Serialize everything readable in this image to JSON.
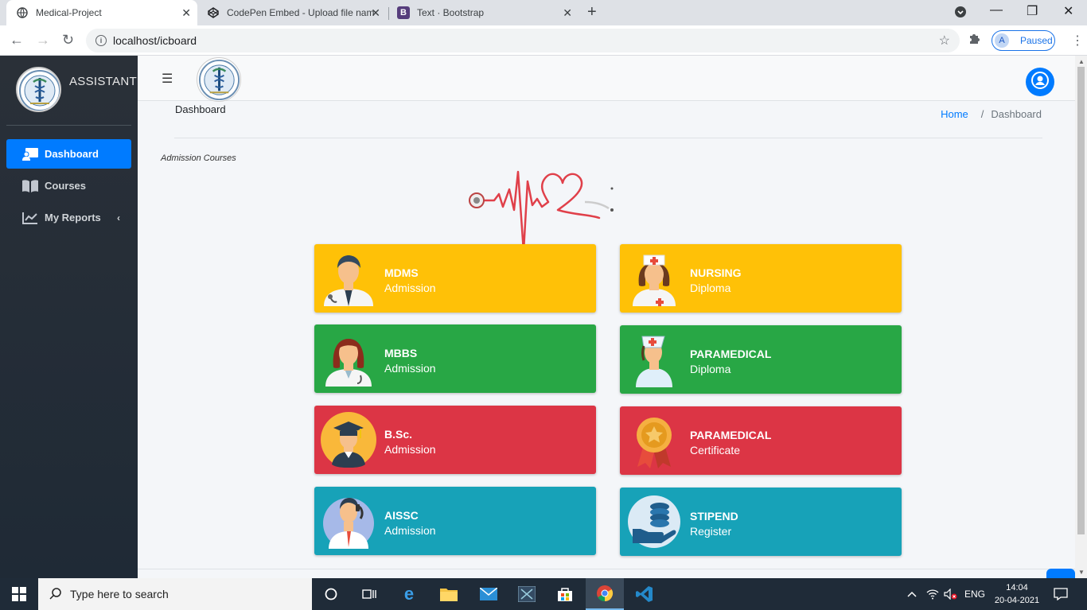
{
  "browser": {
    "tabs": [
      {
        "title": "Medical-Project",
        "active": true
      },
      {
        "title": "CodePen Embed - Upload file nam",
        "active": false
      },
      {
        "title": "Text · Bootstrap",
        "active": false
      }
    ],
    "url": "localhost/icboard",
    "profile_initial": "A",
    "profile_status": "Paused"
  },
  "sidebar": {
    "brand": "ASSISTANT",
    "items": [
      {
        "label": "Dashboard",
        "icon": "dashboard-icon",
        "active": true
      },
      {
        "label": "Courses",
        "icon": "book-icon",
        "active": false
      },
      {
        "label": "My Reports",
        "icon": "chart-line-icon",
        "active": false
      }
    ]
  },
  "header": {
    "page_title": "Dashboard",
    "breadcrumb": {
      "home": "Home",
      "separator": "/",
      "current": "Dashboard"
    }
  },
  "content": {
    "section_label": "Admission Courses",
    "cards": [
      {
        "title": "MDMS",
        "subtitle": "Admission",
        "color": "#ffc107",
        "icon": "doctor-male-icon"
      },
      {
        "title": "NURSING",
        "subtitle": "Diploma",
        "color": "#ffc107",
        "icon": "nurse-icon"
      },
      {
        "title": "MBBS",
        "subtitle": "Admission",
        "color": "#28a745",
        "icon": "doctor-female-icon"
      },
      {
        "title": "PARAMEDICAL",
        "subtitle": "Diploma",
        "color": "#28a745",
        "icon": "paramedic-nurse-icon"
      },
      {
        "title": "B.Sc.",
        "subtitle": "Admission",
        "color": "#dc3545",
        "icon": "graduate-icon"
      },
      {
        "title": "PARAMEDICAL",
        "subtitle": "Certificate",
        "color": "#dc3545",
        "icon": "medal-icon"
      },
      {
        "title": "AISSC",
        "subtitle": "Admission",
        "color": "#17a2b8",
        "icon": "businessman-phone-icon"
      },
      {
        "title": "STIPEND",
        "subtitle": "Register",
        "color": "#17a2b8",
        "icon": "coins-hand-icon"
      }
    ]
  },
  "taskbar": {
    "search_placeholder": "Type here to search",
    "language": "ENG",
    "time": "14:04",
    "date": "20-04-2021"
  }
}
